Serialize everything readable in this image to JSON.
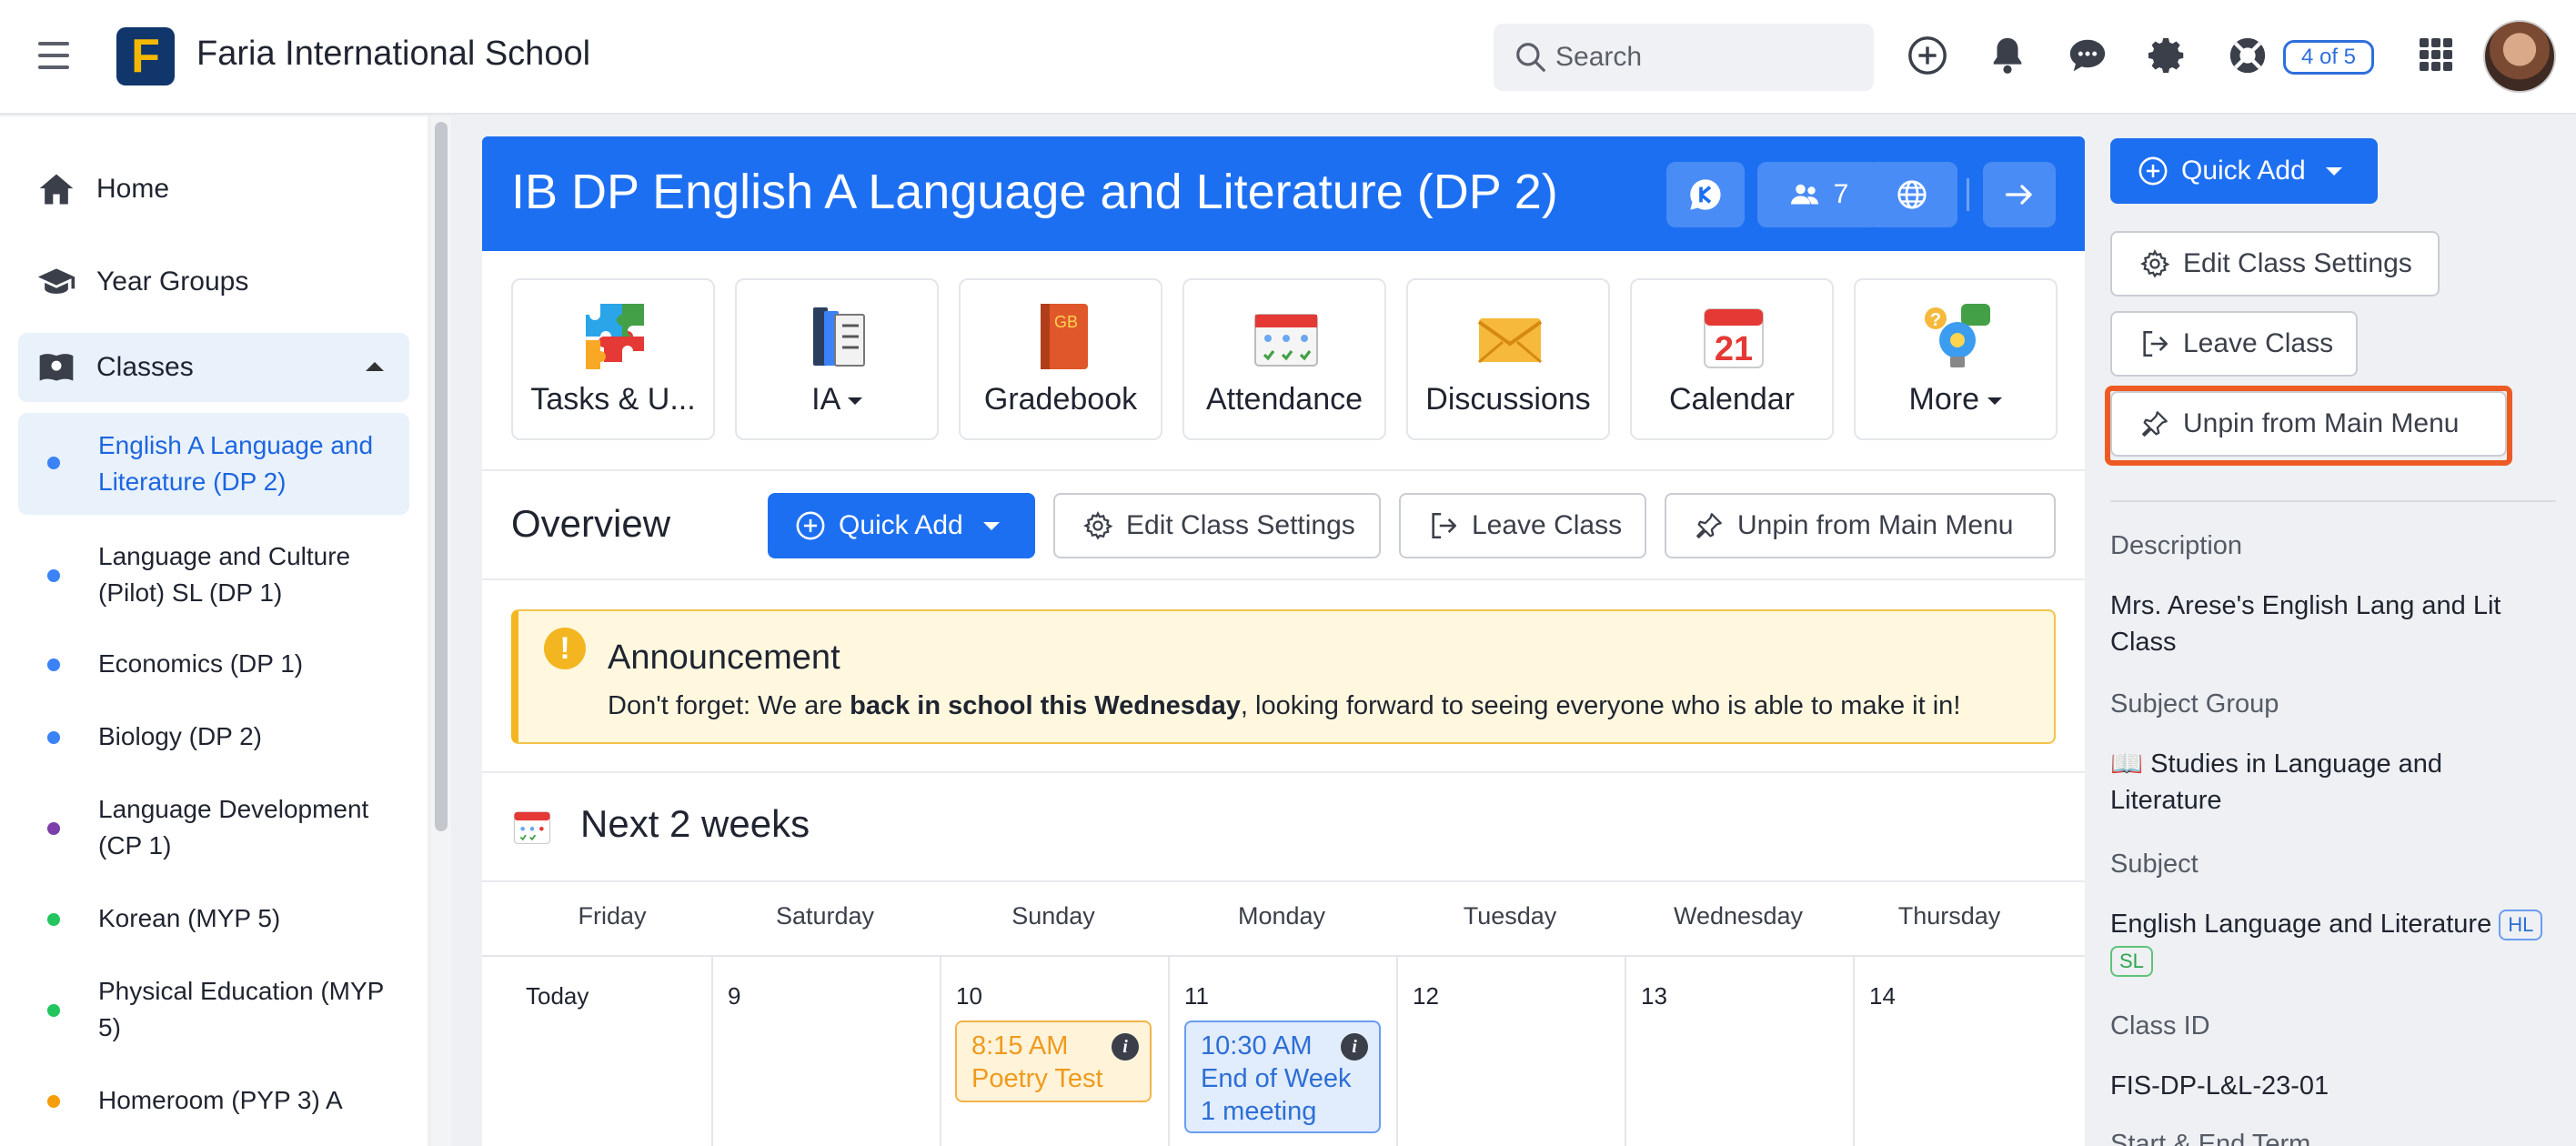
{
  "topbar": {
    "school_name": "Faria International School",
    "logo_letter": "F",
    "search_placeholder": "Search",
    "count_badge": "4 of 5",
    "icons": [
      "menu-icon",
      "plus-circle-icon",
      "bell-icon",
      "chat-icon",
      "gear-icon",
      "lifebuoy-icon",
      "apps-grid-icon"
    ]
  },
  "sidebar": {
    "home": "Home",
    "year_groups": "Year Groups",
    "classes": "Classes",
    "class_items": [
      {
        "label": "English A Language and Literature (DP 2)",
        "color": "#3b82f6",
        "active": true
      },
      {
        "label": "Language and Culture (Pilot) SL (DP 1)",
        "color": "#3b82f6"
      },
      {
        "label": "Economics (DP 1)",
        "color": "#3b82f6"
      },
      {
        "label": "Biology (DP 2)",
        "color": "#3b82f6"
      },
      {
        "label": "Language Development (CP 1)",
        "color": "#7e3fa8"
      },
      {
        "label": "Korean (MYP 5)",
        "color": "#22c55e"
      },
      {
        "label": "Physical Education (MYP 5)",
        "color": "#22c55e"
      },
      {
        "label": "Homeroom (PYP 3) A",
        "color": "#f59e0b"
      }
    ]
  },
  "class_header": {
    "title": "IB DP English A Language and Literature (DP 2)",
    "members_count": "7",
    "accent": "#1d6ff2"
  },
  "tools": [
    {
      "label": "Tasks & U...",
      "icon": "puzzle-icon"
    },
    {
      "label": "IA",
      "icon": "binders-icon"
    },
    {
      "label": "Gradebook",
      "icon": "gradebook-icon"
    },
    {
      "label": "Attendance",
      "icon": "attendance-icon"
    },
    {
      "label": "Discussions",
      "icon": "envelope-icon"
    },
    {
      "label": "Calendar",
      "icon": "calendar-icon",
      "day": "21"
    },
    {
      "label": "More",
      "icon": "lightbulb-icon"
    }
  ],
  "overview": {
    "title": "Overview",
    "quick_add": "Quick Add",
    "edit_settings": "Edit Class Settings",
    "leave_class": "Leave Class",
    "unpin": "Unpin from Main Menu"
  },
  "announcement": {
    "title": "Announcement",
    "body_before": "Don't forget: We are ",
    "body_bold": "back in school this Wednesday",
    "body_after": ", looking forward to seeing everyone who is able to make it in!"
  },
  "next_weeks": {
    "title": "Next 2 weeks",
    "days": [
      "Friday",
      "Saturday",
      "Sunday",
      "Monday",
      "Tuesday",
      "Wednesday",
      "Thursday"
    ],
    "dates": [
      "Today",
      "9",
      "10",
      "11",
      "12",
      "13",
      "14"
    ],
    "events": [
      {
        "time": "8:15 AM",
        "title": "Poetry Test"
      },
      {
        "time": "10:30 AM",
        "title": "End of Week 1 meeting"
      }
    ]
  },
  "right_panel": {
    "quick_add": "Quick Add",
    "edit_settings": "Edit Class Settings",
    "leave_class": "Leave Class",
    "unpin": "Unpin from Main Menu",
    "highlight_color": "#ee5a24",
    "description_label": "Description",
    "description": "Mrs. Arese's English Lang and Lit Class",
    "subject_group_label": "Subject Group",
    "subject_group": "📖 Studies in Language and Literature",
    "subject_label": "Subject",
    "subject": "English Language and Literature",
    "tag_hl": "HL",
    "tag_sl": "SL",
    "class_id_label": "Class ID",
    "class_id": "FIS-DP-L&L-23-01",
    "start_end_label": "Start & End Term"
  }
}
